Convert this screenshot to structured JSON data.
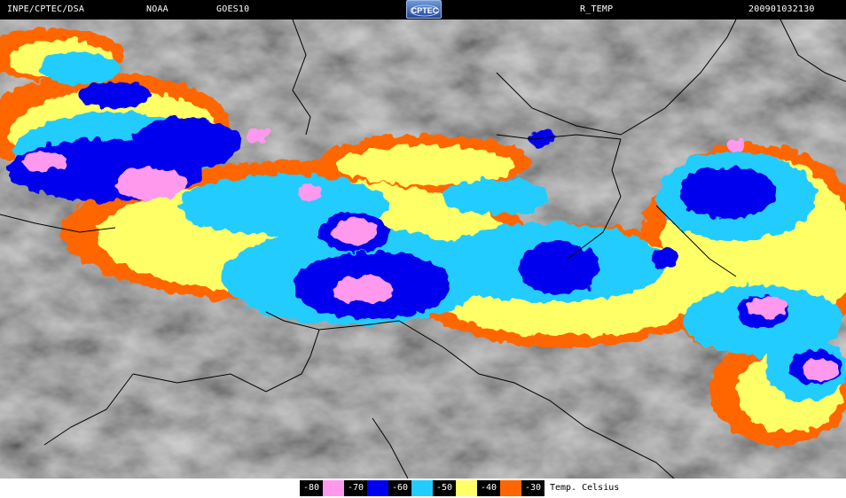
{
  "header": {
    "org": "INPE/CPTEC/DSA",
    "agency": "NOAA",
    "satellite": "GOES10",
    "logo_text": "CPTEC",
    "product": "R_TEMP",
    "timestamp": "200901032130"
  },
  "legend": {
    "title": "Temp. Celsius",
    "classes": [
      {
        "label": "-80",
        "color": "#ff99ee"
      },
      {
        "label": "-70",
        "color": "#0000ee"
      },
      {
        "label": "-60",
        "color": "#22ccff"
      },
      {
        "label": "-50",
        "color": "#ffff66"
      },
      {
        "label": "-40",
        "color": "#ff6600"
      },
      {
        "label": "-30",
        "color": "#000000"
      }
    ]
  },
  "colors": {
    "background_cloud_gray": "#777777",
    "borders": "#000000"
  }
}
